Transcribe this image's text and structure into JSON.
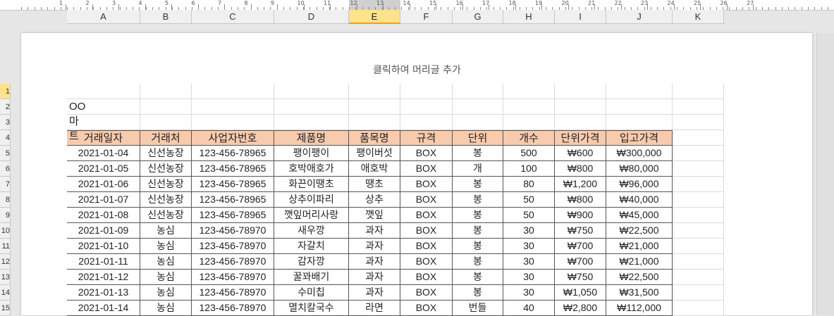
{
  "ruler": {
    "numbers": [
      "1",
      "2",
      "3",
      "4",
      "5",
      "6",
      "7",
      "8",
      "9",
      "10",
      "11",
      "12",
      "13",
      "14",
      "15",
      "16",
      "17",
      "18",
      "19",
      "20",
      "21",
      "22",
      "23",
      "24",
      "25",
      "26",
      "27"
    ]
  },
  "columns": [
    "A",
    "B",
    "C",
    "D",
    "E",
    "F",
    "G",
    "H",
    "I",
    "J",
    "K"
  ],
  "selected_column": "E",
  "rows": [
    "1",
    "2",
    "3",
    "4",
    "5",
    "6",
    "7",
    "8",
    "9",
    "10",
    "11",
    "12",
    "13",
    "14",
    "15"
  ],
  "selected_row": "1",
  "header_placeholder": "클릭하여 머리글 추가",
  "store_name": "OO 마트",
  "table": {
    "headers": [
      "거래일자",
      "거래처",
      "사업자번호",
      "제품명",
      "품목명",
      "규격",
      "단위",
      "개수",
      "단위가격",
      "입고가격"
    ],
    "rows": [
      [
        "2021-01-04",
        "신선농장",
        "123-456-78965",
        "팽이팽이",
        "팽이버섯",
        "BOX",
        "봉",
        "500",
        "₩600",
        "₩300,000"
      ],
      [
        "2021-01-05",
        "신선농장",
        "123-456-78965",
        "호박애호가",
        "애호박",
        "BOX",
        "개",
        "100",
        "₩800",
        "₩80,000"
      ],
      [
        "2021-01-06",
        "신선농장",
        "123-456-78965",
        "화끈이땡초",
        "땡초",
        "BOX",
        "봉",
        "80",
        "₩1,200",
        "₩96,000"
      ],
      [
        "2021-01-07",
        "신선농장",
        "123-456-78965",
        "상추이파리",
        "상추",
        "BOX",
        "봉",
        "50",
        "₩800",
        "₩40,000"
      ],
      [
        "2021-01-08",
        "신선농장",
        "123-456-78965",
        "깻잎머리사랑",
        "깻잎",
        "BOX",
        "봉",
        "50",
        "₩900",
        "₩45,000"
      ],
      [
        "2021-01-09",
        "농심",
        "123-456-78970",
        "새우깡",
        "과자",
        "BOX",
        "봉",
        "30",
        "₩750",
        "₩22,500"
      ],
      [
        "2021-01-10",
        "농심",
        "123-456-78970",
        "자갈치",
        "과자",
        "BOX",
        "봉",
        "30",
        "₩700",
        "₩21,000"
      ],
      [
        "2021-01-11",
        "농심",
        "123-456-78970",
        "감자깡",
        "과자",
        "BOX",
        "봉",
        "30",
        "₩700",
        "₩21,000"
      ],
      [
        "2021-01-12",
        "농심",
        "123-456-78970",
        "꿀꽈배기",
        "과자",
        "BOX",
        "봉",
        "30",
        "₩750",
        "₩22,500"
      ],
      [
        "2021-01-13",
        "농심",
        "123-456-78970",
        "수미칩",
        "과자",
        "BOX",
        "봉",
        "30",
        "₩1,050",
        "₩31,500"
      ],
      [
        "2021-01-14",
        "농심",
        "123-456-78970",
        "멸치칼국수",
        "라면",
        "BOX",
        "번들",
        "40",
        "₩2,800",
        "₩112,000"
      ]
    ]
  },
  "colors": {
    "header_fill": "#f8cbad",
    "selected_header": "#ffe28a",
    "accent": "#e8a317"
  }
}
